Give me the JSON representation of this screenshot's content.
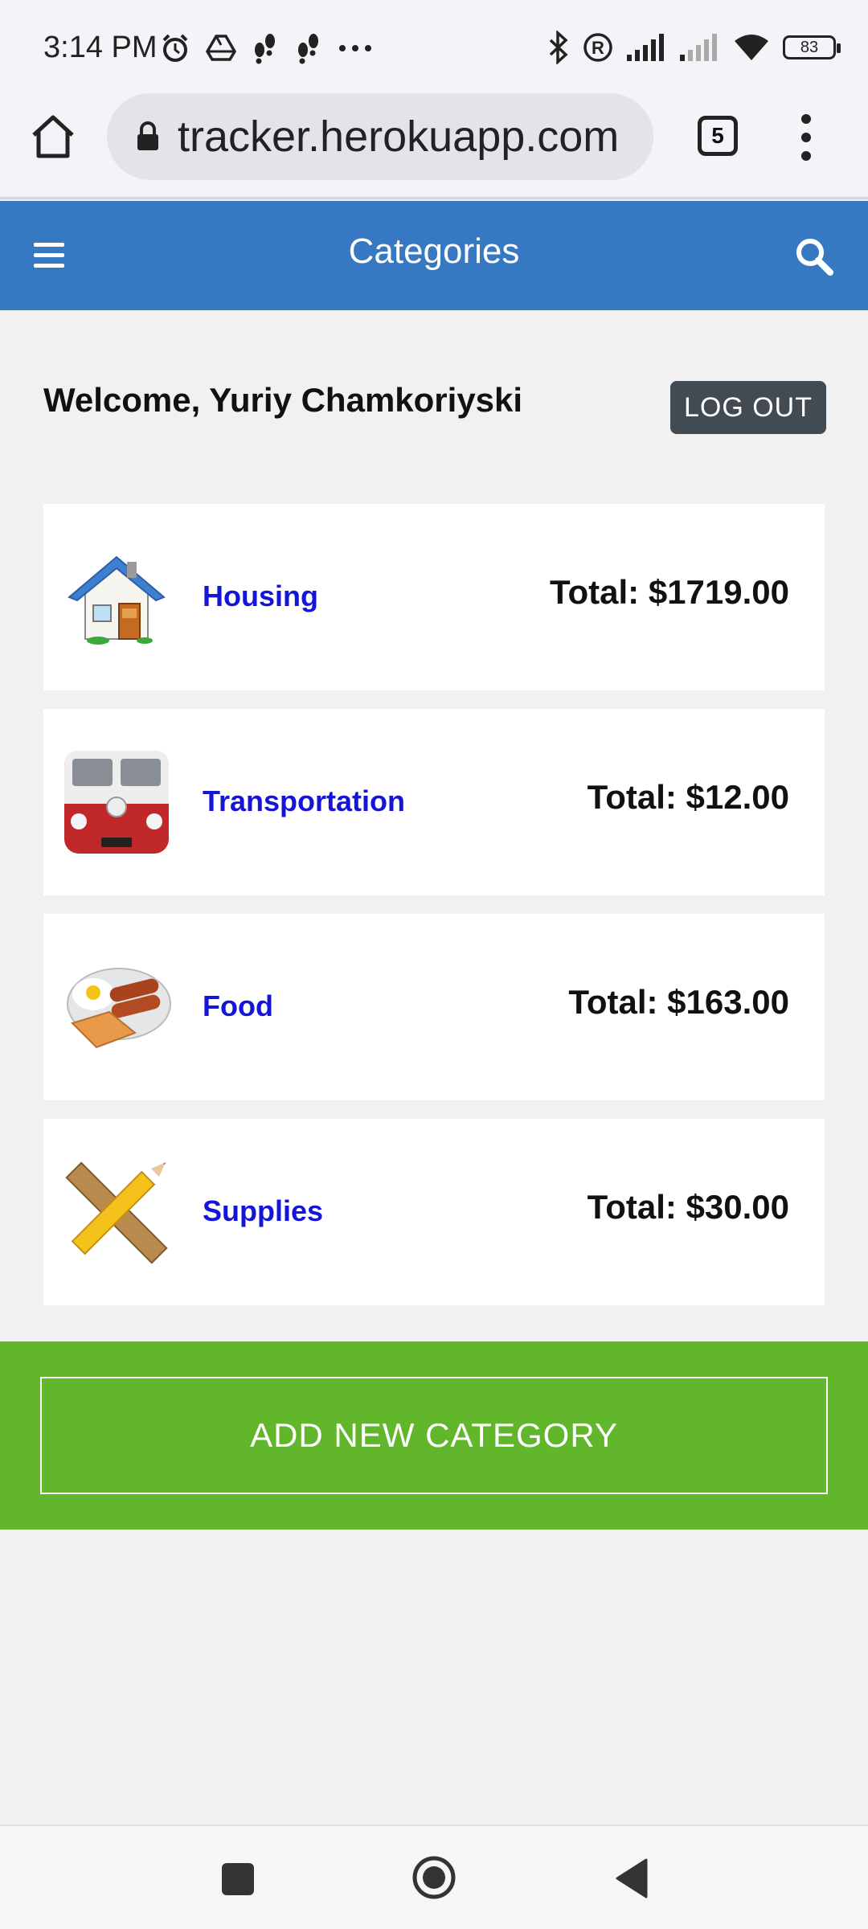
{
  "status_bar": {
    "time": "3:14 PM",
    "battery": "83",
    "icons_left": [
      "alarm-icon",
      "drive-icon",
      "steps-icon",
      "steps-icon",
      "more-dots-icon"
    ],
    "icons_right": [
      "bluetooth-icon",
      "registered-icon",
      "signal-icon",
      "signal-weak-icon",
      "wifi-icon",
      "battery-icon"
    ]
  },
  "browser": {
    "url": "tracker.herokuapp.com",
    "tab_count": "5"
  },
  "header": {
    "title": "Categories"
  },
  "welcome": {
    "text": "Welcome, Yuriy Chamkoriyski",
    "logout_label": "LOG OUT"
  },
  "categories": [
    {
      "name": "Housing",
      "total": "Total: $1719.00",
      "icon": "house-icon"
    },
    {
      "name": "Transportation",
      "total": "Total: $12.00",
      "icon": "van-icon"
    },
    {
      "name": "Food",
      "total": "Total: $163.00",
      "icon": "breakfast-icon"
    },
    {
      "name": "Supplies",
      "total": "Total: $30.00",
      "icon": "pencil-ruler-icon"
    }
  ],
  "actions": {
    "add_category_label": "ADD NEW CATEGORY"
  },
  "colors": {
    "header_bg": "#3778c2",
    "link": "#1515d8",
    "add_band": "#61b62c",
    "logout_bg": "#424a52",
    "page_bg": "#f0f1f0"
  }
}
